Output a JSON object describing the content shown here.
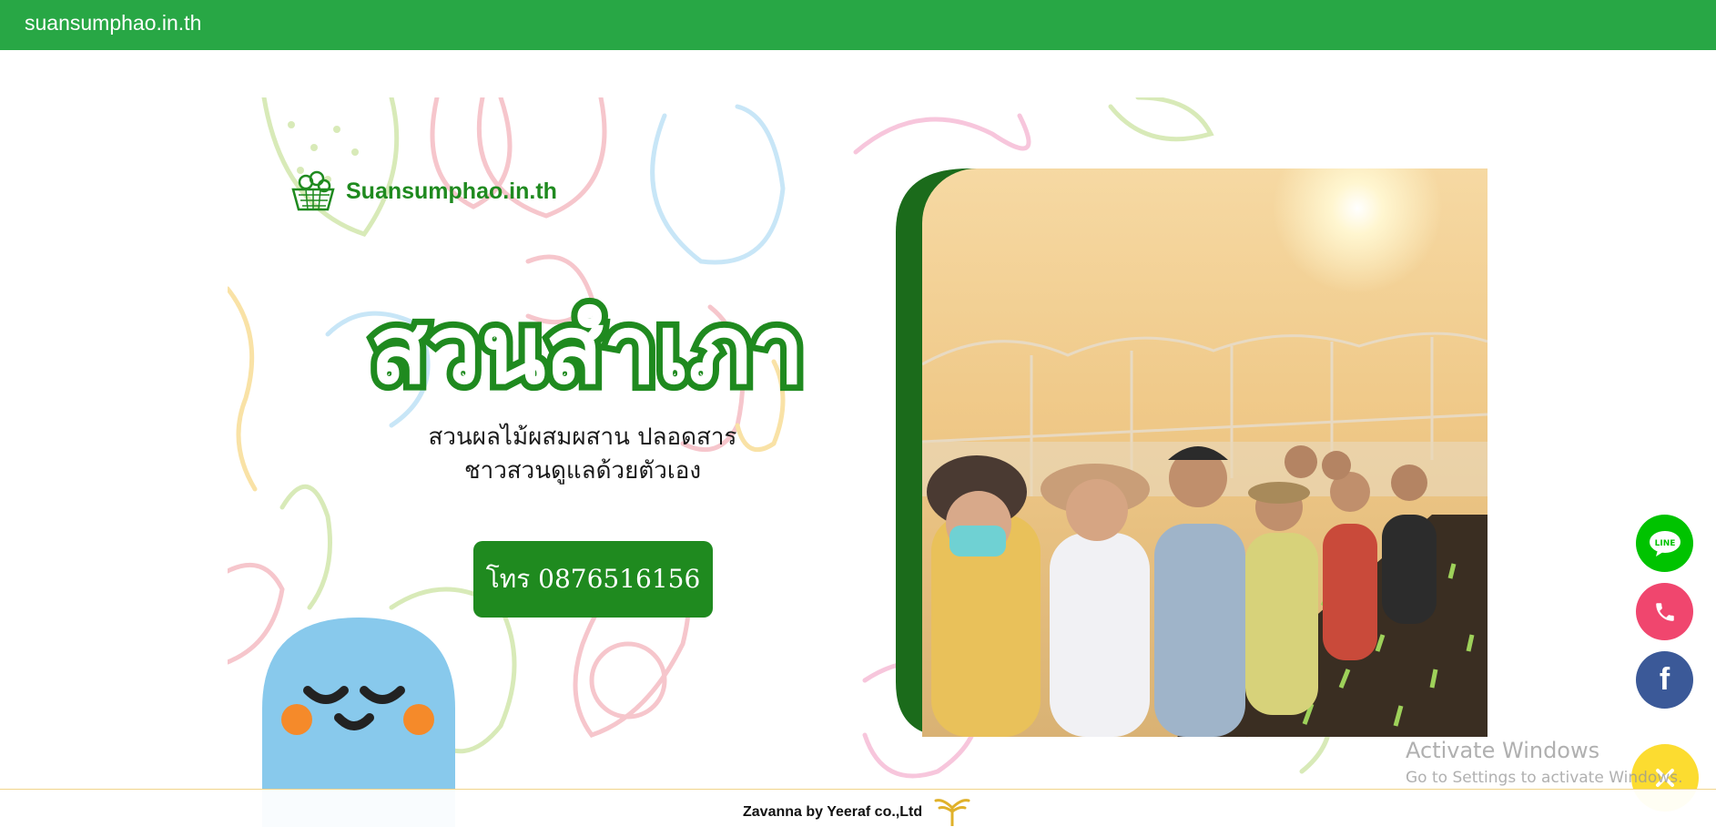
{
  "browser": {
    "site_title": "suansumphao.in.th"
  },
  "hero": {
    "brand_name": "Suansumphao.in.th",
    "big_title": "สวนสำเภา",
    "subtitle_line1": "สวนผลไม้ผสมผสาน ปลอดสาร",
    "subtitle_line2": "ชาวสวนดูแลด้วยตัวเอง",
    "call_button": "โทร 0876516156",
    "colors": {
      "brand_green": "#1f8a1f",
      "topbar_green": "#28a745"
    }
  },
  "floating_contacts": [
    {
      "icon": "line-icon",
      "label": "LINE",
      "color": "#00c300"
    },
    {
      "icon": "phone-icon",
      "color": "#f0466e"
    },
    {
      "icon": "facebook-icon",
      "label": "f",
      "color": "#3b5998"
    },
    {
      "icon": "close-icon",
      "color": "#fcdc30"
    }
  ],
  "watermark": {
    "line1": "Activate Windows",
    "line2": "Go to Settings to activate Windows."
  },
  "footer": {
    "credit": "Zavanna by Yeeraf co.,Ltd"
  }
}
